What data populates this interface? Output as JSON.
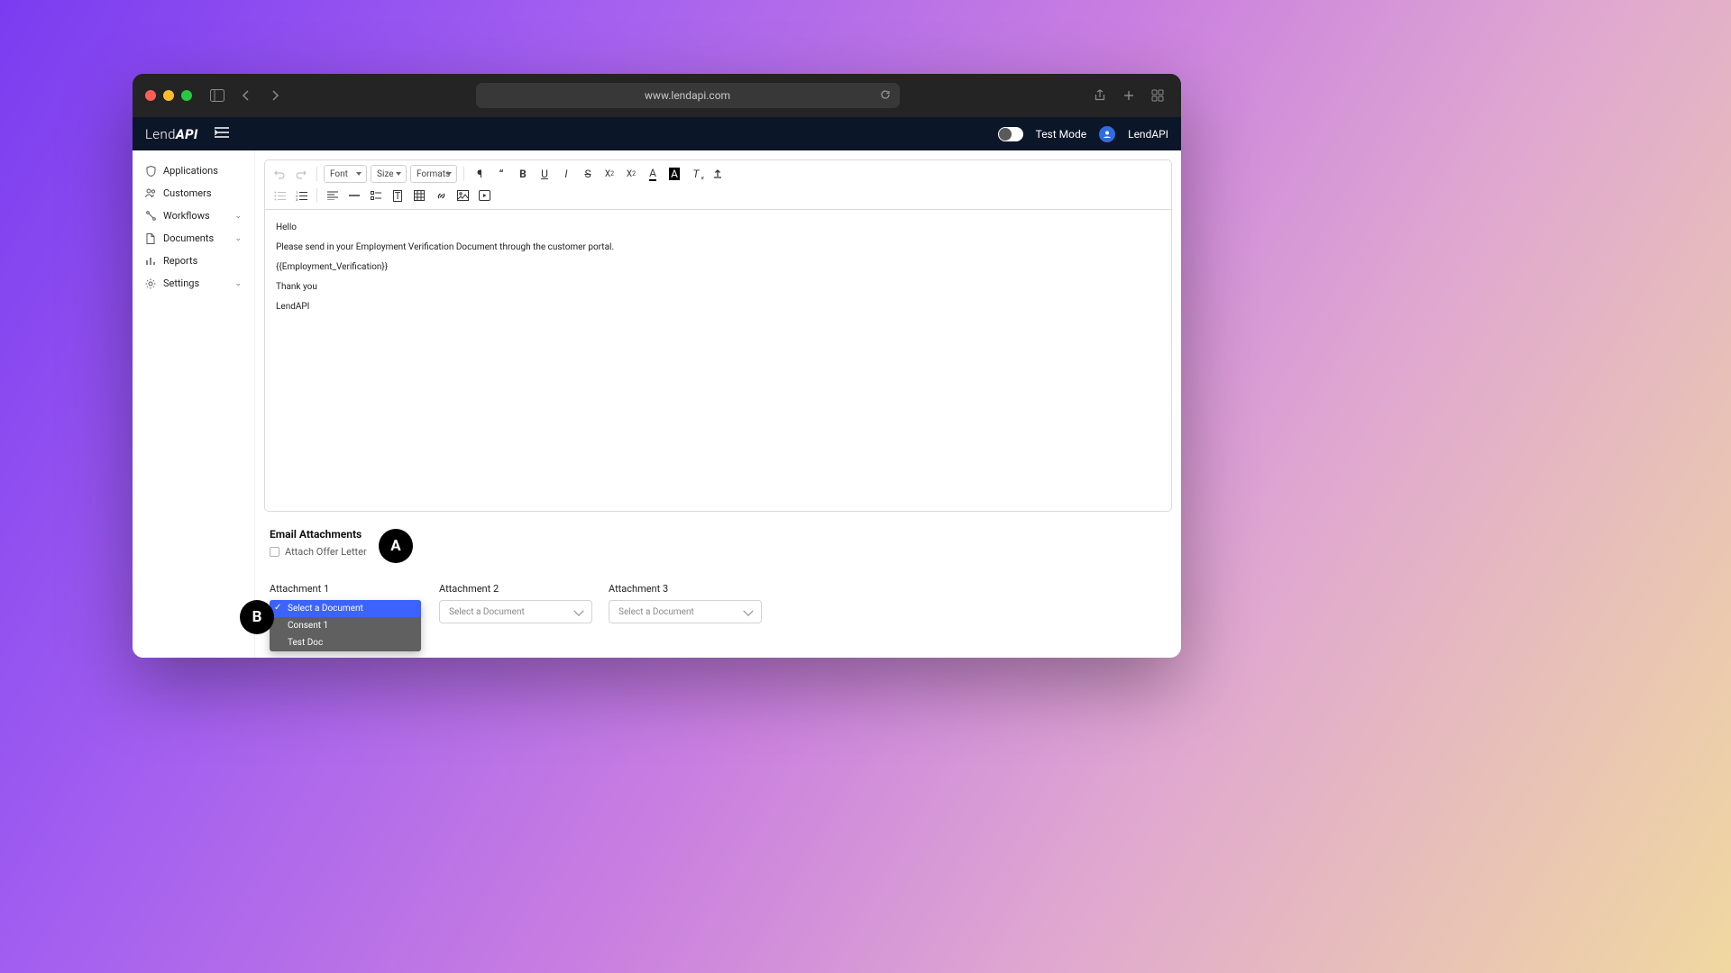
{
  "chrome": {
    "url": "www.lendapi.com"
  },
  "header": {
    "logo_pre": "Lend",
    "logo_post": "API",
    "test_mode_label": "Test Mode",
    "account_label": "LendAPI"
  },
  "sidebar": {
    "items": [
      {
        "label": "Applications",
        "icon": "shield",
        "expandable": false
      },
      {
        "label": "Customers",
        "icon": "users",
        "expandable": false
      },
      {
        "label": "Workflows",
        "icon": "flow",
        "expandable": true
      },
      {
        "label": "Documents",
        "icon": "doc",
        "expandable": true
      },
      {
        "label": "Reports",
        "icon": "chart",
        "expandable": false
      },
      {
        "label": "Settings",
        "icon": "gear",
        "expandable": true
      }
    ]
  },
  "editor": {
    "toolbar": {
      "font_label": "Font",
      "size_label": "Size",
      "formats_label": "Formats"
    },
    "body": {
      "p1": "Hello",
      "p2": "Please send in your Employment Verification Document through the customer portal.",
      "p3": "{{Employment_Verification}}",
      "p4": "Thank you",
      "p5": "LendAPI"
    }
  },
  "attachments": {
    "section_title": "Email Attachments",
    "offer_letter_label": "Attach Offer Letter",
    "slots": [
      {
        "label": "Attachment 1",
        "placeholder": "Select a Document"
      },
      {
        "label": "Attachment 2",
        "placeholder": "Select a Document"
      },
      {
        "label": "Attachment 3",
        "placeholder": "Select a Document"
      }
    ],
    "dropdown_options": [
      "Select a Document",
      "Consent 1",
      "Test Doc"
    ]
  },
  "annotations": {
    "a": "A",
    "b": "B"
  }
}
